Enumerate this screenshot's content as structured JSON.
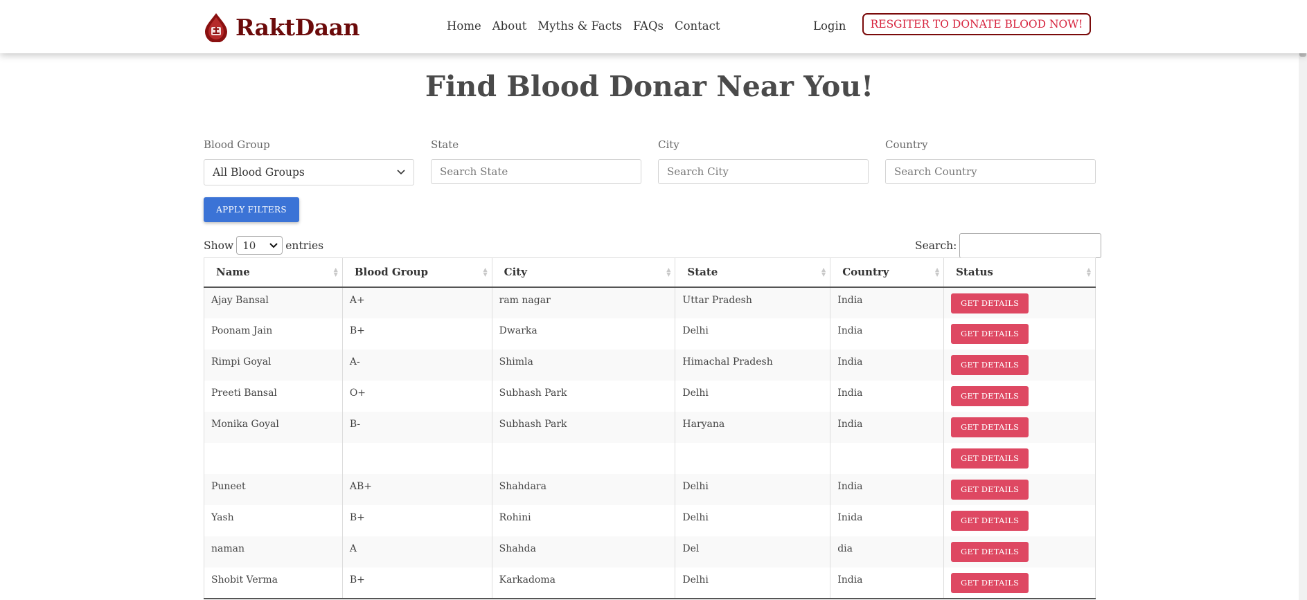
{
  "brand": {
    "name": "RaktDaan",
    "logo_icon": "blood-drop-logo-icon",
    "color": "#6b0a0a"
  },
  "nav": {
    "links": [
      "Home",
      "About",
      "Myths & Facts",
      "FAQs",
      "Contact"
    ],
    "login": "Login",
    "register": "RESGITER TO DONATE BLOOD NOW!"
  },
  "page": {
    "title": "Find Blood Donar Near You!"
  },
  "filters": {
    "blood_group": {
      "label": "Blood Group",
      "value": "All Blood Groups"
    },
    "state": {
      "label": "State",
      "placeholder": "Search State"
    },
    "city": {
      "label": "City",
      "placeholder": "Search City"
    },
    "country": {
      "label": "Country",
      "placeholder": "Search Country"
    },
    "apply_label": "APPLY FILTERS"
  },
  "table_controls": {
    "show": "Show",
    "entries_value": "10",
    "entries": "entries",
    "search_label": "Search:"
  },
  "table": {
    "columns": [
      "Name",
      "Blood Group",
      "City",
      "State",
      "Country",
      "Status"
    ],
    "rows": [
      [
        "Ajay Bansal",
        "A+",
        "ram nagar",
        "Uttar Pradesh",
        "India"
      ],
      [
        "Poonam Jain",
        "B+",
        "Dwarka",
        "Delhi",
        "India"
      ],
      [
        "Rimpi Goyal",
        "A-",
        "Shimla",
        "Himachal Pradesh",
        "India"
      ],
      [
        "Preeti Bansal",
        "O+",
        "Subhash Park",
        "Delhi",
        "India"
      ],
      [
        "Monika Goyal",
        "B-",
        "Subhash Park",
        "Haryana",
        "India"
      ],
      [
        "",
        "",
        "",
        "",
        ""
      ],
      [
        "Puneet",
        "AB+",
        "Shahdara",
        "Delhi",
        "India"
      ],
      [
        "Yash",
        "B+",
        "Rohini",
        "Delhi",
        "Inida"
      ],
      [
        "naman",
        "A",
        "Shahda",
        "Del",
        "dia"
      ],
      [
        "Shobit Verma",
        "B+",
        "Karkadoma",
        "Delhi",
        "India"
      ]
    ],
    "action_label": "GET DETAILS"
  },
  "colors": {
    "primary_blue": "#3b73d6",
    "details_red": "#de4862",
    "register_red": "#d6223c"
  }
}
